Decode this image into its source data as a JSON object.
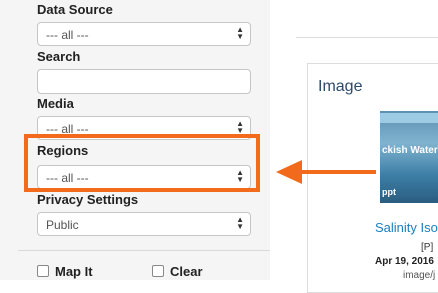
{
  "filters": {
    "data_source": {
      "label": "Data Source",
      "value": "--- all ---"
    },
    "search": {
      "label": "Search",
      "value": ""
    },
    "media": {
      "label": "Media",
      "value": "--- all ---"
    },
    "regions": {
      "label": "Regions",
      "value": "--- all ---"
    },
    "privacy": {
      "label": "Privacy Settings",
      "value": "Public"
    }
  },
  "options": {
    "map_it": "Map It",
    "clear": "Clear"
  },
  "result_card": {
    "heading": "Image",
    "thumbnail_text": "ckish Water",
    "thumbnail_subtext": "ppt",
    "link_text": "Salinity Iso",
    "tag": "[P]",
    "date": "Apr 19, 2016",
    "type": "image/j"
  },
  "colors": {
    "highlight": "#f26a1b",
    "link": "#1a7fbf",
    "panel_background": "#f5f5f5"
  }
}
